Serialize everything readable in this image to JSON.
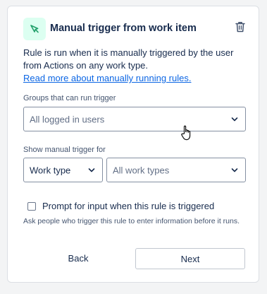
{
  "header": {
    "title": "Manual trigger from work item",
    "trigger_icon": "manual-trigger-icon",
    "delete_icon": "trash-icon"
  },
  "description": {
    "text": "Rule is run when it is manually triggered by the user from Actions on any work type.",
    "link": "Read more about manually running rules."
  },
  "groups": {
    "label": "Groups that can run trigger",
    "value": "All logged in users"
  },
  "show_for": {
    "label": "Show manual trigger for",
    "type_value": "Work type",
    "items_value": "All work types"
  },
  "prompt": {
    "checked": false,
    "label": "Prompt for input when this rule is triggered",
    "helper": "Ask people who trigger this rule to enter information before it runs."
  },
  "buttons": {
    "back": "Back",
    "next": "Next"
  },
  "colors": {
    "link": "#0c66e4",
    "icon_bg": "#dcfff1",
    "icon_fg": "#22a06b"
  }
}
